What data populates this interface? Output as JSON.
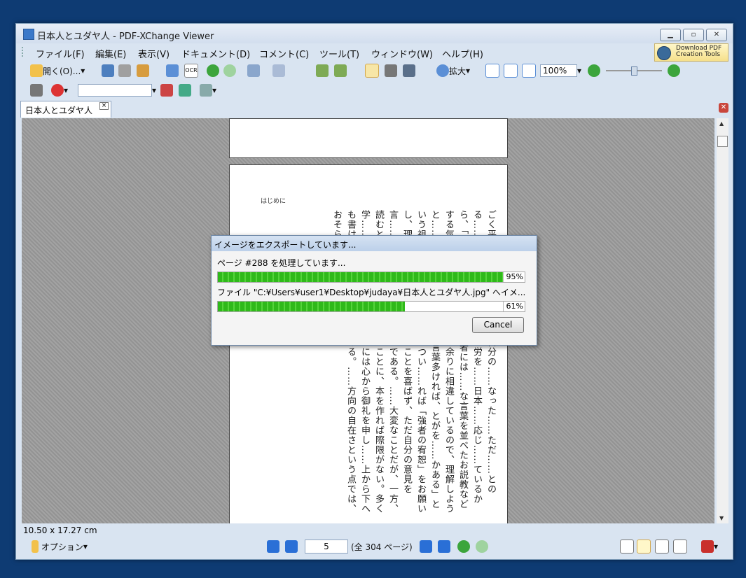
{
  "window": {
    "title": "日本人とユダヤ人 - PDF-XChange Viewer"
  },
  "menu": [
    "ファイル(F)",
    "編集(E)",
    "表示(V)",
    "ドキュメント(D)",
    "コメント(C)",
    "ツール(T)",
    "ウィンドウ(W)",
    "ヘルプ(H)"
  ],
  "download": {
    "line1": "Download PDF",
    "line2": "Creation Tools"
  },
  "toolbar": {
    "open_label": "開く(O)...",
    "ocr_label": "OCR",
    "zoom_in_label": "拡大",
    "zoom_value": "100%",
    "search_value": ""
  },
  "tab": {
    "label": "日本人とユダヤ人"
  },
  "page": {
    "header": "はじめに",
    "text": "ごく平……かわら、もな……自分の……なった……ただ……とのる……本……古き……れる……労を……日本……応じ……ているから、「すぐれた言葉は愚かなる者には……な言葉を並べたお説教などする気は全くなかっ……歴史も余りに相違しているので、理解しようと……々あることと思うし、「言葉多ければ、とがを……かある」という祖先の教えを守りきれず、つい……れば「強者の宥恕」をお願いし、理解不足の点……者は悟ることを喜ばず、ただ自分の意見を言……先祖様に相すまないからである。……大変なことだが、一方、読むという努力もまた……「まことに、本を作れば際限がない。多く学……でくださろうとする方々には心から御礼を申し……上から下へも書けるし、左から右へも書ける。……方向の自在さという点では、おそらく世界最高"
  },
  "dialog": {
    "title": "イメージをエクスポートしています...",
    "line1": "ページ #288 を処理しています...",
    "progress1": 0.95,
    "progress1_label": "95%",
    "line2": "ファイル \"C:¥Users¥user1¥Desktop¥judaya¥日本人とユダヤ人.jpg\" へイメ...",
    "progress2": 0.61,
    "progress2_label": "61%",
    "cancel": "Cancel"
  },
  "status": {
    "page_size": "10.50 x 17.27 cm"
  },
  "nav": {
    "options_label": "オプション",
    "current_page": "5",
    "total_label": "(全 304 ページ)"
  }
}
